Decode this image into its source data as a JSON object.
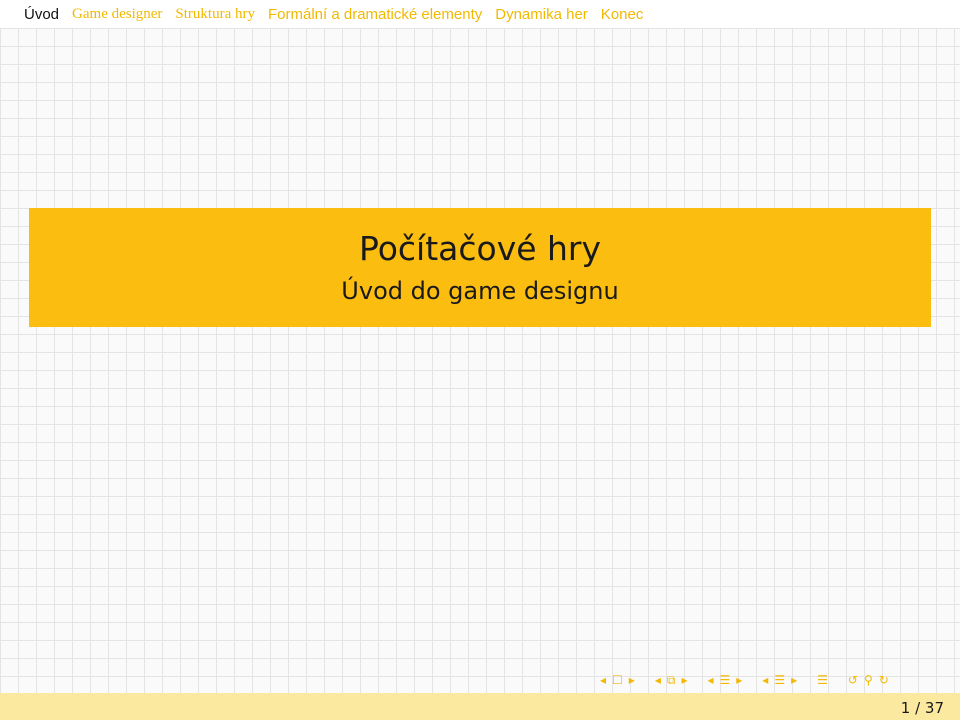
{
  "nav": {
    "items": [
      {
        "label": "Úvod",
        "active": true
      },
      {
        "label": "Game designer",
        "active": false
      },
      {
        "label": "Struktura hry",
        "active": false
      },
      {
        "label": "Formální a dramatické elementy",
        "active": false
      },
      {
        "label": "Dynamika her",
        "active": false
      },
      {
        "label": "Konec",
        "active": false
      }
    ]
  },
  "slide": {
    "title": "Počítačové hry",
    "subtitle": "Úvod do game designu"
  },
  "footer": {
    "page_current": "1",
    "page_separator": "/",
    "page_total": "37",
    "page_label": "1 / 37"
  },
  "colors": {
    "accent": "#fbbd10",
    "nav_text": "#f2b900",
    "footer_bg": "#fce9a0"
  },
  "icons": [
    "prev-frame-icon",
    "frame-icon",
    "next-frame-icon",
    "prev-subsection-icon",
    "subsection-icon",
    "next-subsection-icon",
    "prev-section-icon",
    "section-icon",
    "next-section-icon",
    "prev-doc-icon",
    "doc-icon",
    "next-doc-icon",
    "appendix-icon",
    "back-icon",
    "search-icon",
    "forward-icon"
  ]
}
